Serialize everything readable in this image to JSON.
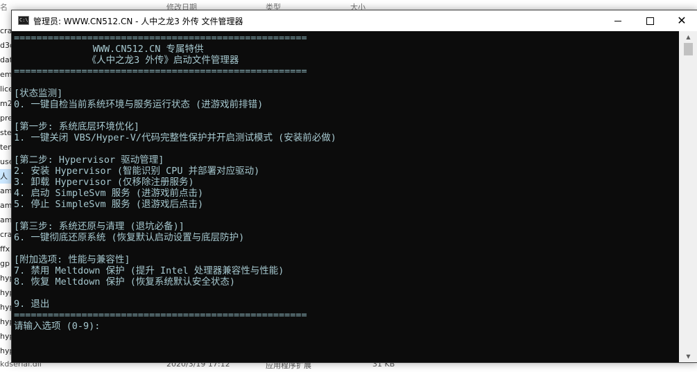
{
  "background": {
    "header": {
      "name_col": "名",
      "date_col": "修改日期",
      "type_col": "类型",
      "size_col": "大小"
    },
    "files": [
      "cra",
      "d3d",
      "dat",
      "em",
      "lice",
      "m2",
      "pre",
      "ste",
      "ten",
      "use",
      "人",
      "am",
      "am",
      "am",
      "cra",
      "ffx",
      "gp",
      "hyp",
      "hyp",
      "hyp",
      "hyp",
      "hyp",
      "hyp"
    ],
    "footer": {
      "name": "kdserial.dll",
      "date": "2020/3/19 17:12",
      "type": "应用程序扩展",
      "size": "31 KB"
    }
  },
  "window": {
    "title": "管理员: WWW.CN512.CN - 人中之龙3 外传 文件管理器",
    "icon_label": "C:\\",
    "minimize": "—",
    "maximize": "□",
    "close": "✕"
  },
  "console": {
    "lines": [
      "====================================================",
      "              WWW.CN512.CN 专属特供",
      "             《人中之龙3 外传》启动文件管理器",
      "====================================================",
      "",
      "[状态监测]",
      "0. 一键自检当前系统环境与服务运行状态 (进游戏前排错)",
      "",
      "[第一步: 系统底层环境优化]",
      "1. 一键关闭 VBS/Hyper-V/代码完整性保护并开启测试模式 (安装前必做)",
      "",
      "[第二步: Hypervisor 驱动管理]",
      "2. 安装 Hypervisor (智能识别 CPU 并部署对应驱动)",
      "3. 卸载 Hypervisor (仅移除注册服务)",
      "4. 启动 SimpleSvm 服务 (进游戏前点击)",
      "5. 停止 SimpleSvm 服务 (退游戏后点击)",
      "",
      "[第三步: 系统还原与清理 (退坑必备)]",
      "6. 一键彻底还原系统 (恢复默认启动设置与底层防护)",
      "",
      "[附加选项: 性能与兼容性]",
      "7. 禁用 Meltdown 保护 (提升 Intel 处理器兼容性与性能)",
      "8. 恢复 Meltdown 保护 (恢复系统默认安全状态)",
      "",
      "9. 退出",
      "====================================================",
      "请输入选项 (0-9):"
    ]
  },
  "colors": {
    "console_bg": "#0c0c0c",
    "console_text": "#a6c8cf",
    "titlebar_bg": "#ffffff"
  }
}
